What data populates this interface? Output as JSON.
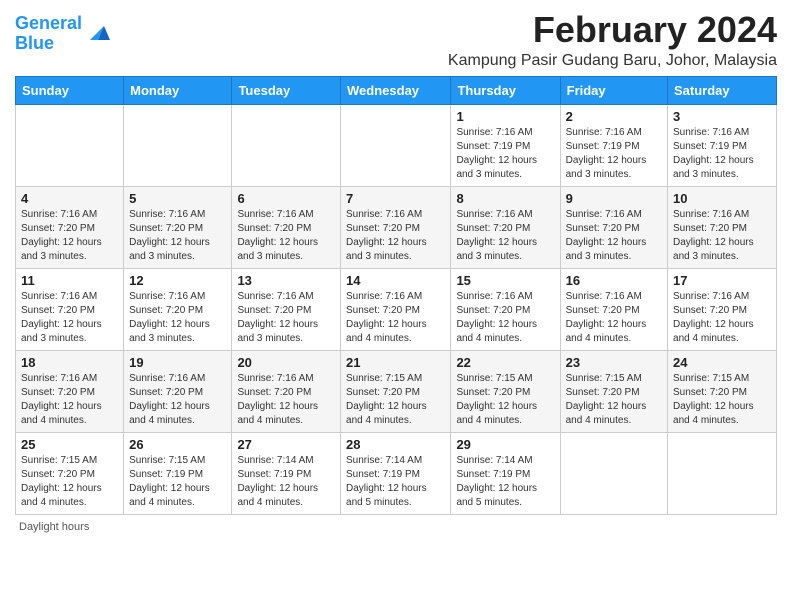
{
  "logo": {
    "line1": "General",
    "line2": "Blue"
  },
  "title": "February 2024",
  "location": "Kampung Pasir Gudang Baru, Johor, Malaysia",
  "days_of_week": [
    "Sunday",
    "Monday",
    "Tuesday",
    "Wednesday",
    "Thursday",
    "Friday",
    "Saturday"
  ],
  "weeks": [
    [
      {
        "day": "",
        "info": ""
      },
      {
        "day": "",
        "info": ""
      },
      {
        "day": "",
        "info": ""
      },
      {
        "day": "",
        "info": ""
      },
      {
        "day": "1",
        "info": "Sunrise: 7:16 AM\nSunset: 7:19 PM\nDaylight: 12 hours\nand 3 minutes."
      },
      {
        "day": "2",
        "info": "Sunrise: 7:16 AM\nSunset: 7:19 PM\nDaylight: 12 hours\nand 3 minutes."
      },
      {
        "day": "3",
        "info": "Sunrise: 7:16 AM\nSunset: 7:19 PM\nDaylight: 12 hours\nand 3 minutes."
      }
    ],
    [
      {
        "day": "4",
        "info": "Sunrise: 7:16 AM\nSunset: 7:20 PM\nDaylight: 12 hours\nand 3 minutes."
      },
      {
        "day": "5",
        "info": "Sunrise: 7:16 AM\nSunset: 7:20 PM\nDaylight: 12 hours\nand 3 minutes."
      },
      {
        "day": "6",
        "info": "Sunrise: 7:16 AM\nSunset: 7:20 PM\nDaylight: 12 hours\nand 3 minutes."
      },
      {
        "day": "7",
        "info": "Sunrise: 7:16 AM\nSunset: 7:20 PM\nDaylight: 12 hours\nand 3 minutes."
      },
      {
        "day": "8",
        "info": "Sunrise: 7:16 AM\nSunset: 7:20 PM\nDaylight: 12 hours\nand 3 minutes."
      },
      {
        "day": "9",
        "info": "Sunrise: 7:16 AM\nSunset: 7:20 PM\nDaylight: 12 hours\nand 3 minutes."
      },
      {
        "day": "10",
        "info": "Sunrise: 7:16 AM\nSunset: 7:20 PM\nDaylight: 12 hours\nand 3 minutes."
      }
    ],
    [
      {
        "day": "11",
        "info": "Sunrise: 7:16 AM\nSunset: 7:20 PM\nDaylight: 12 hours\nand 3 minutes."
      },
      {
        "day": "12",
        "info": "Sunrise: 7:16 AM\nSunset: 7:20 PM\nDaylight: 12 hours\nand 3 minutes."
      },
      {
        "day": "13",
        "info": "Sunrise: 7:16 AM\nSunset: 7:20 PM\nDaylight: 12 hours\nand 3 minutes."
      },
      {
        "day": "14",
        "info": "Sunrise: 7:16 AM\nSunset: 7:20 PM\nDaylight: 12 hours\nand 4 minutes."
      },
      {
        "day": "15",
        "info": "Sunrise: 7:16 AM\nSunset: 7:20 PM\nDaylight: 12 hours\nand 4 minutes."
      },
      {
        "day": "16",
        "info": "Sunrise: 7:16 AM\nSunset: 7:20 PM\nDaylight: 12 hours\nand 4 minutes."
      },
      {
        "day": "17",
        "info": "Sunrise: 7:16 AM\nSunset: 7:20 PM\nDaylight: 12 hours\nand 4 minutes."
      }
    ],
    [
      {
        "day": "18",
        "info": "Sunrise: 7:16 AM\nSunset: 7:20 PM\nDaylight: 12 hours\nand 4 minutes."
      },
      {
        "day": "19",
        "info": "Sunrise: 7:16 AM\nSunset: 7:20 PM\nDaylight: 12 hours\nand 4 minutes."
      },
      {
        "day": "20",
        "info": "Sunrise: 7:16 AM\nSunset: 7:20 PM\nDaylight: 12 hours\nand 4 minutes."
      },
      {
        "day": "21",
        "info": "Sunrise: 7:15 AM\nSunset: 7:20 PM\nDaylight: 12 hours\nand 4 minutes."
      },
      {
        "day": "22",
        "info": "Sunrise: 7:15 AM\nSunset: 7:20 PM\nDaylight: 12 hours\nand 4 minutes."
      },
      {
        "day": "23",
        "info": "Sunrise: 7:15 AM\nSunset: 7:20 PM\nDaylight: 12 hours\nand 4 minutes."
      },
      {
        "day": "24",
        "info": "Sunrise: 7:15 AM\nSunset: 7:20 PM\nDaylight: 12 hours\nand 4 minutes."
      }
    ],
    [
      {
        "day": "25",
        "info": "Sunrise: 7:15 AM\nSunset: 7:20 PM\nDaylight: 12 hours\nand 4 minutes."
      },
      {
        "day": "26",
        "info": "Sunrise: 7:15 AM\nSunset: 7:19 PM\nDaylight: 12 hours\nand 4 minutes."
      },
      {
        "day": "27",
        "info": "Sunrise: 7:14 AM\nSunset: 7:19 PM\nDaylight: 12 hours\nand 4 minutes."
      },
      {
        "day": "28",
        "info": "Sunrise: 7:14 AM\nSunset: 7:19 PM\nDaylight: 12 hours\nand 5 minutes."
      },
      {
        "day": "29",
        "info": "Sunrise: 7:14 AM\nSunset: 7:19 PM\nDaylight: 12 hours\nand 5 minutes."
      },
      {
        "day": "",
        "info": ""
      },
      {
        "day": "",
        "info": ""
      }
    ]
  ],
  "footer": {
    "daylight_label": "Daylight hours"
  }
}
